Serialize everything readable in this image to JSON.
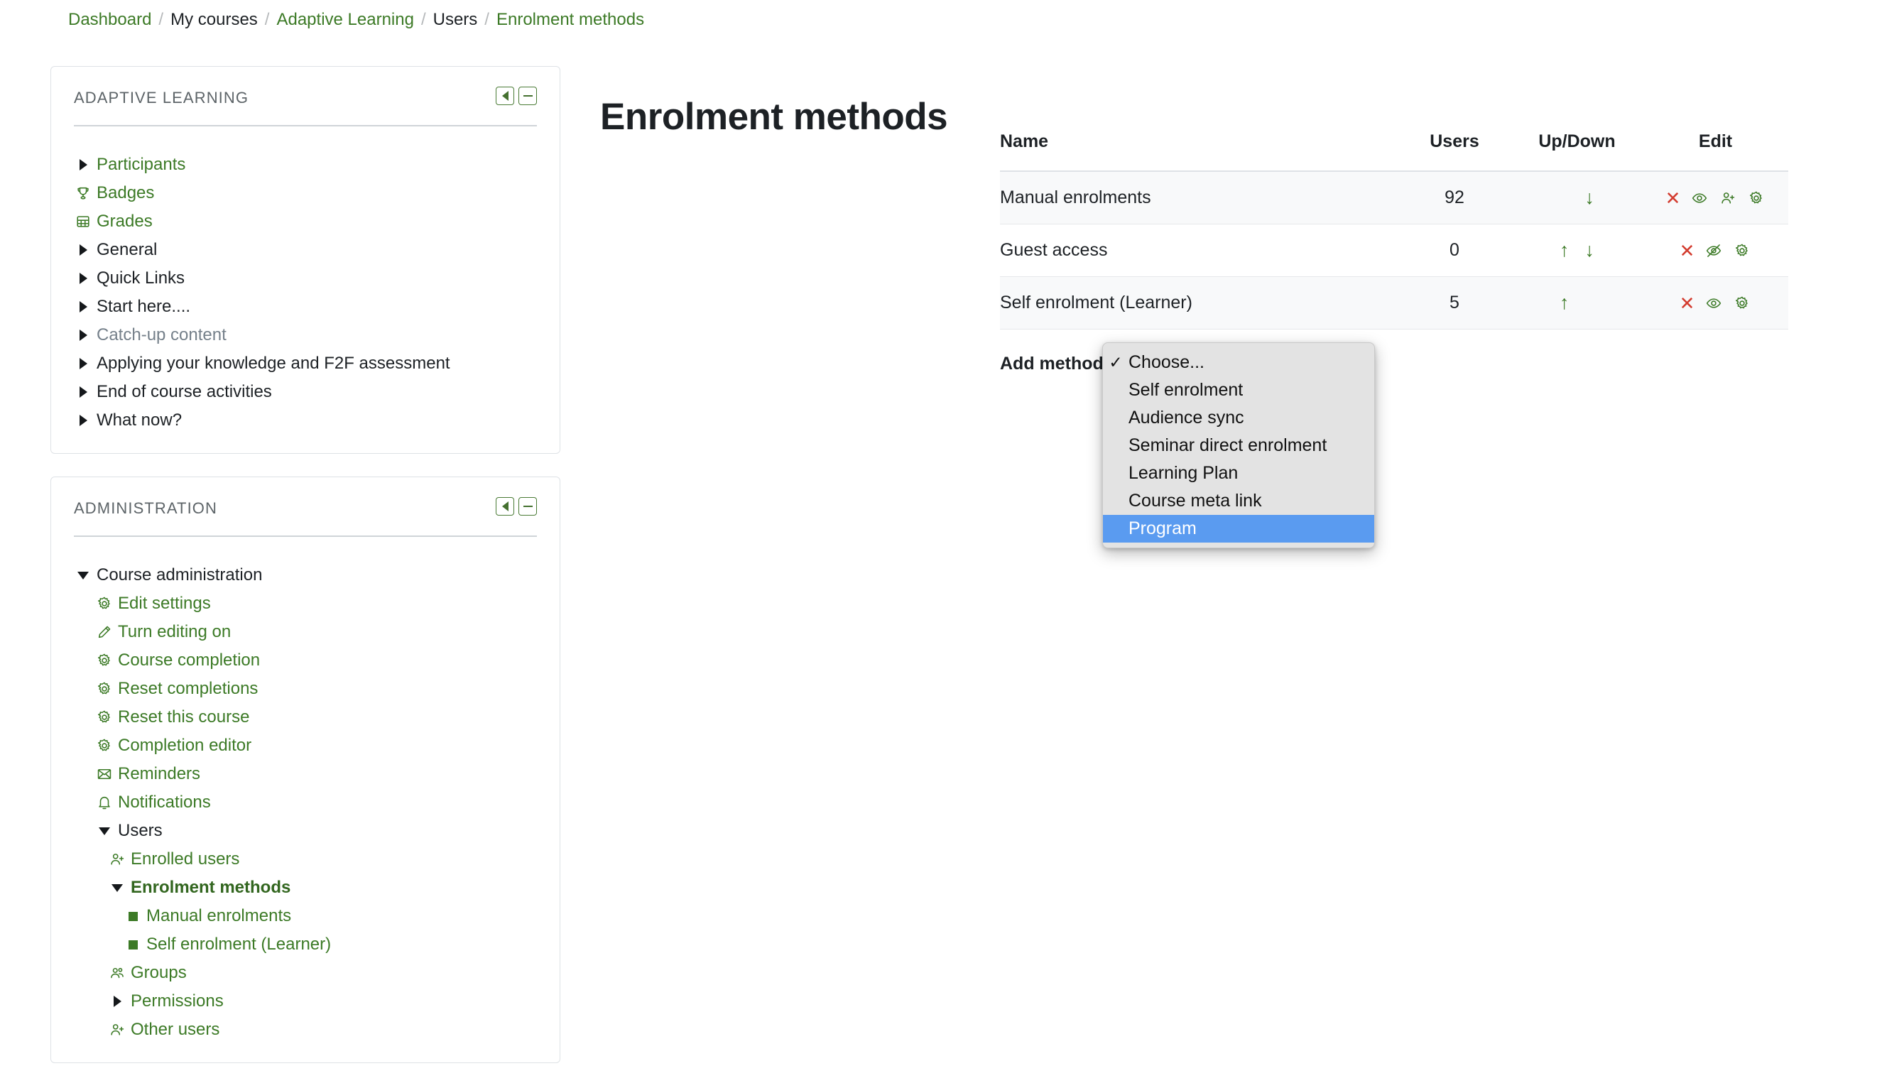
{
  "breadcrumb": [
    {
      "label": "Dashboard",
      "link": true
    },
    {
      "label": "My courses",
      "link": false
    },
    {
      "label": "Adaptive Learning",
      "link": true
    },
    {
      "label": "Users",
      "link": false
    },
    {
      "label": "Enrolment methods",
      "link": true
    }
  ],
  "breadcrumb_separator": "/",
  "blocks": [
    {
      "title": "ADAPTIVE LEARNING",
      "items": [
        {
          "label": "Participants",
          "icon": "caret-right-icon",
          "style": "link"
        },
        {
          "label": "Badges",
          "icon": "trophy-icon",
          "style": "link"
        },
        {
          "label": "Grades",
          "icon": "grades-table-icon",
          "style": "link"
        },
        {
          "label": "General",
          "icon": "caret-right-icon",
          "style": "dark"
        },
        {
          "label": "Quick Links",
          "icon": "caret-right-icon",
          "style": "dark"
        },
        {
          "label": "Start here....",
          "icon": "caret-right-icon",
          "style": "dark"
        },
        {
          "label": "Catch-up content",
          "icon": "caret-right-icon",
          "style": "muted"
        },
        {
          "label": "Applying your knowledge and F2F assessment",
          "icon": "caret-right-icon",
          "style": "dark"
        },
        {
          "label": "End of course activities",
          "icon": "caret-right-icon",
          "style": "dark"
        },
        {
          "label": "What now?",
          "icon": "caret-right-icon",
          "style": "dark"
        }
      ]
    },
    {
      "title": "ADMINISTRATION",
      "items": [
        {
          "label": "Course administration",
          "icon": "caret-down-icon",
          "style": "dark",
          "indent": 0
        },
        {
          "label": "Edit settings",
          "icon": "gear-icon",
          "style": "link",
          "indent": 1
        },
        {
          "label": "Turn editing on",
          "icon": "pencil-icon",
          "style": "link",
          "indent": 1
        },
        {
          "label": "Course completion",
          "icon": "gear-icon",
          "style": "link",
          "indent": 1
        },
        {
          "label": "Reset completions",
          "icon": "gear-icon",
          "style": "link",
          "indent": 1
        },
        {
          "label": "Reset this course",
          "icon": "gear-icon",
          "style": "link",
          "indent": 1
        },
        {
          "label": "Completion editor",
          "icon": "gear-icon",
          "style": "link",
          "indent": 1
        },
        {
          "label": "Reminders",
          "icon": "envelope-icon",
          "style": "link",
          "indent": 1
        },
        {
          "label": "Notifications",
          "icon": "bell-icon",
          "style": "link",
          "indent": 1
        },
        {
          "label": "Users",
          "icon": "caret-down-icon",
          "style": "dark",
          "indent": 1
        },
        {
          "label": "Enrolled users",
          "icon": "user-plus-icon",
          "style": "link",
          "indent": 2
        },
        {
          "label": "Enrolment methods",
          "icon": "caret-down-icon",
          "style": "current",
          "indent": 2
        },
        {
          "label": "Manual enrolments",
          "icon": "square-bullet-icon",
          "style": "link",
          "indent": 3
        },
        {
          "label": "Self enrolment (Learner)",
          "icon": "square-bullet-icon",
          "style": "link",
          "indent": 3
        },
        {
          "label": "Groups",
          "icon": "users-group-icon",
          "style": "link",
          "indent": 2
        },
        {
          "label": "Permissions",
          "icon": "caret-right-icon",
          "style": "link",
          "indent": 2
        },
        {
          "label": "Other users",
          "icon": "user-plus-icon",
          "style": "link",
          "indent": 2
        }
      ]
    }
  ],
  "main": {
    "title": "Enrolment methods",
    "table": {
      "headers": [
        "Name",
        "Users",
        "Up/Down",
        "Edit"
      ],
      "rows": [
        {
          "name": "Manual enrolments",
          "dimmed": false,
          "users": "92",
          "up": false,
          "down": true,
          "edit_icons": [
            "delete-icon",
            "eye-icon",
            "enrol-users-icon",
            "gear-icon"
          ]
        },
        {
          "name": "Guest access",
          "dimmed": true,
          "users": "0",
          "up": true,
          "down": true,
          "edit_icons": [
            "delete-icon",
            "eye-slash-icon",
            "gear-icon"
          ]
        },
        {
          "name": "Self enrolment (Learner)",
          "dimmed": false,
          "users": "5",
          "up": true,
          "down": false,
          "edit_icons": [
            "delete-icon",
            "eye-icon",
            "gear-icon"
          ]
        }
      ]
    },
    "add_method_label": "Add method",
    "add_method_options": [
      {
        "label": "Choose...",
        "checked": true,
        "selected": false
      },
      {
        "label": "Self enrolment",
        "checked": false,
        "selected": false
      },
      {
        "label": "Audience sync",
        "checked": false,
        "selected": false
      },
      {
        "label": "Seminar direct enrolment",
        "checked": false,
        "selected": false
      },
      {
        "label": "Learning Plan",
        "checked": false,
        "selected": false
      },
      {
        "label": "Course meta link",
        "checked": false,
        "selected": false
      },
      {
        "label": "Program",
        "checked": false,
        "selected": true
      }
    ],
    "checkmark_glyph": "✓",
    "arrow_up_glyph": "↑",
    "arrow_down_glyph": "↓",
    "delete_glyph": "✕"
  },
  "colors": {
    "link_green": "#3c7a26",
    "delete_red": "#d33c2f",
    "highlight_blue": "#5a9bf0",
    "muted_grey": "#75808a",
    "popup_bg": "#e3e3e3"
  }
}
